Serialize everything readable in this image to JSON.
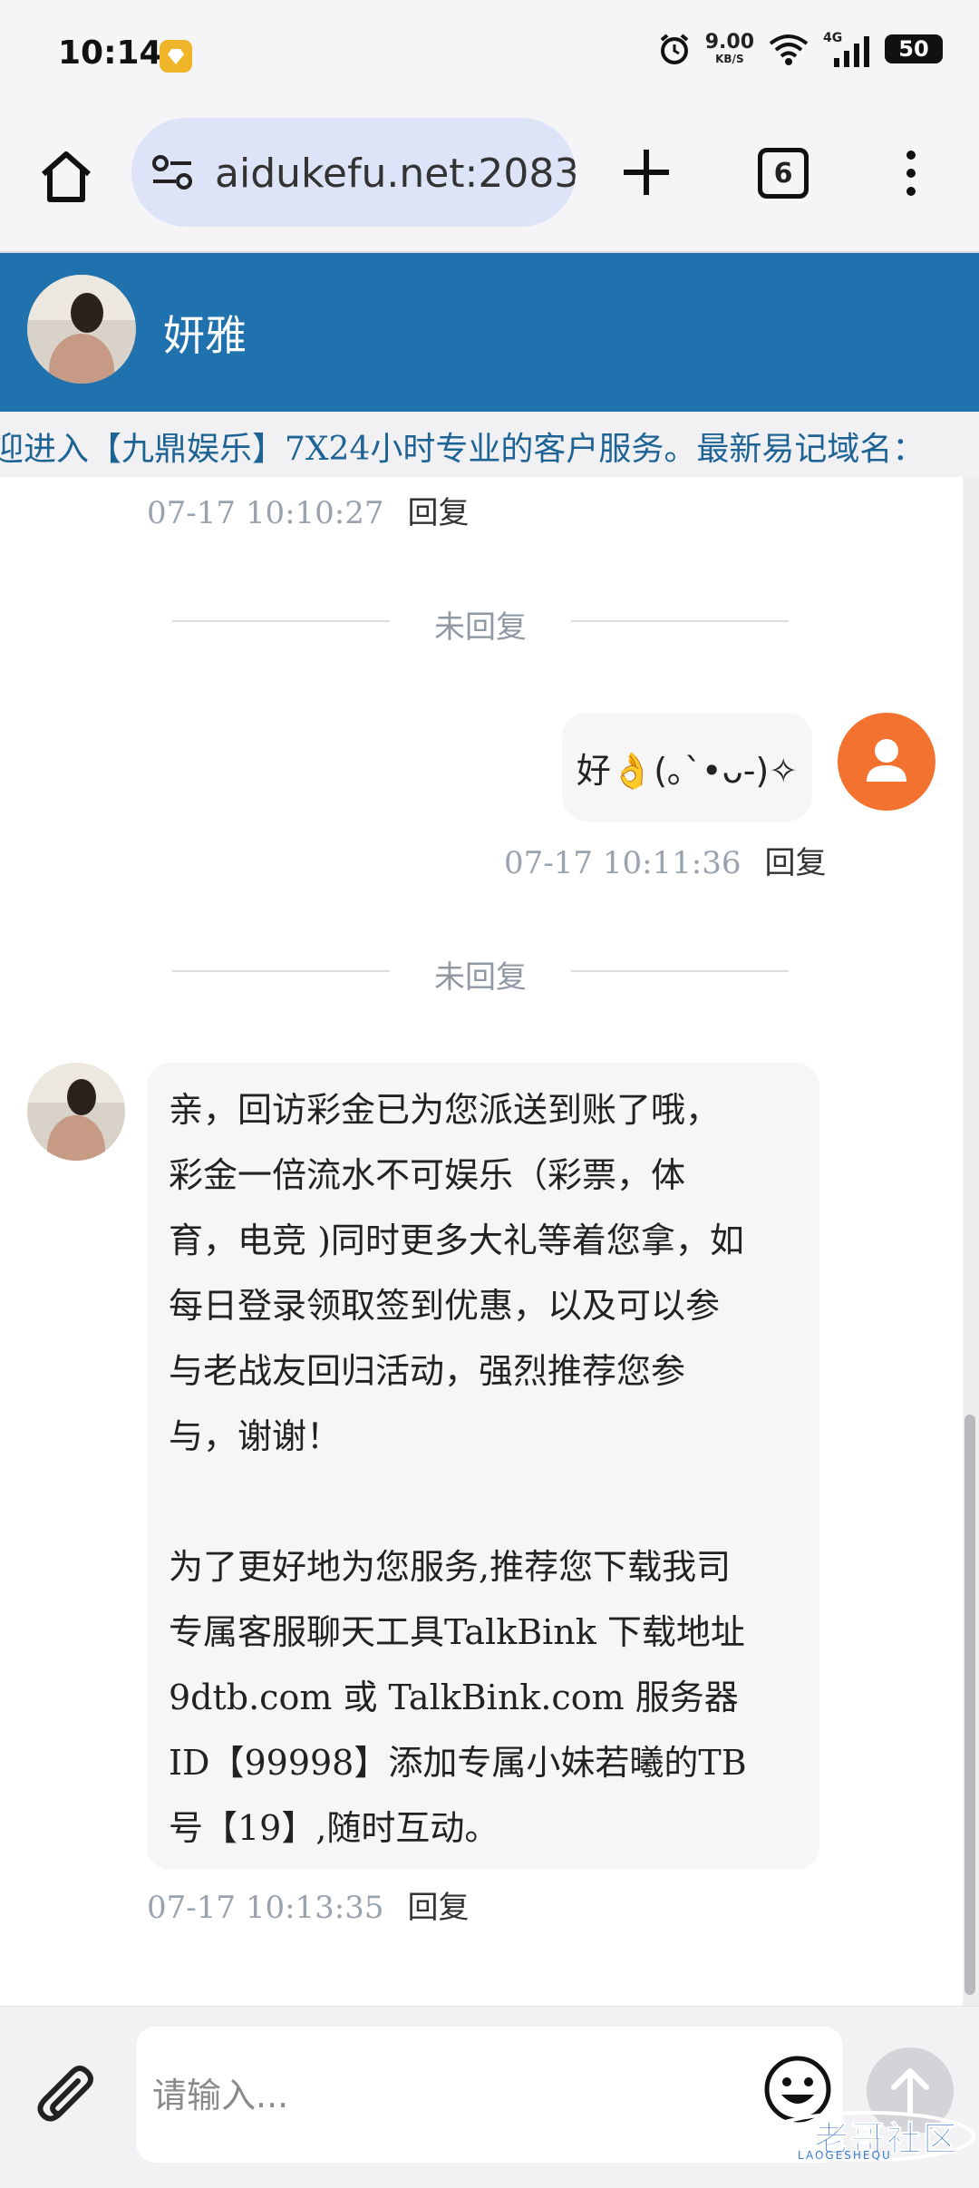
{
  "status_bar": {
    "time": "10:14",
    "net_speed": "9.00",
    "net_unit": "KB/S",
    "net_type": "4G",
    "battery": "50"
  },
  "browser": {
    "url": "aidukefu.net:2083",
    "tab_count": "6"
  },
  "chat": {
    "contact_name": "妍雅",
    "marquee": "迎进入【九鼎娱乐】7X24小时专业的客户服务。最新易记域名："
  },
  "messages": {
    "first_meta": {
      "time": "07-17 10:10:27",
      "reply": "回复"
    },
    "divider_1": "未回复",
    "outgoing": {
      "text": "好👌(｡`•ᴗ-)✧",
      "time": "07-17 10:11:36",
      "reply": "回复"
    },
    "divider_2": "未回复",
    "incoming": {
      "text": "亲，回访彩金已为您派送到账了哦，\n彩金一倍流水不可娱乐（彩票，体\n育，电竞 )同时更多大礼等着您拿，如\n每日登录领取签到优惠，以及可以参\n与老战友回归活动，强烈推荐您参\n与，谢谢！\n\n为了更好地为您服务,推荐您下载我司\n专属客服聊天工具TalkBink 下载地址\n9dtb.com 或 TalkBink.com 服务器\nID【99998】添加专属小妹若曦的TB\n号【19】,随时互动。",
      "time": "07-17 10:13:35",
      "reply": "回复"
    }
  },
  "input": {
    "placeholder": "请输入..."
  },
  "watermark": {
    "title": "老哥社区",
    "sub": "LAOGESHEQU"
  },
  "icons": {
    "home": "home-icon",
    "site_settings": "tune-icon",
    "new_tab": "plus-icon",
    "menu": "more-vert-icon",
    "attach": "paperclip-icon",
    "emoji": "smiley-icon",
    "send": "arrow-up-icon"
  },
  "colors": {
    "header_blue": "#1f72ad",
    "user_avatar": "#f4722f",
    "url_bar": "#dde4f7"
  }
}
